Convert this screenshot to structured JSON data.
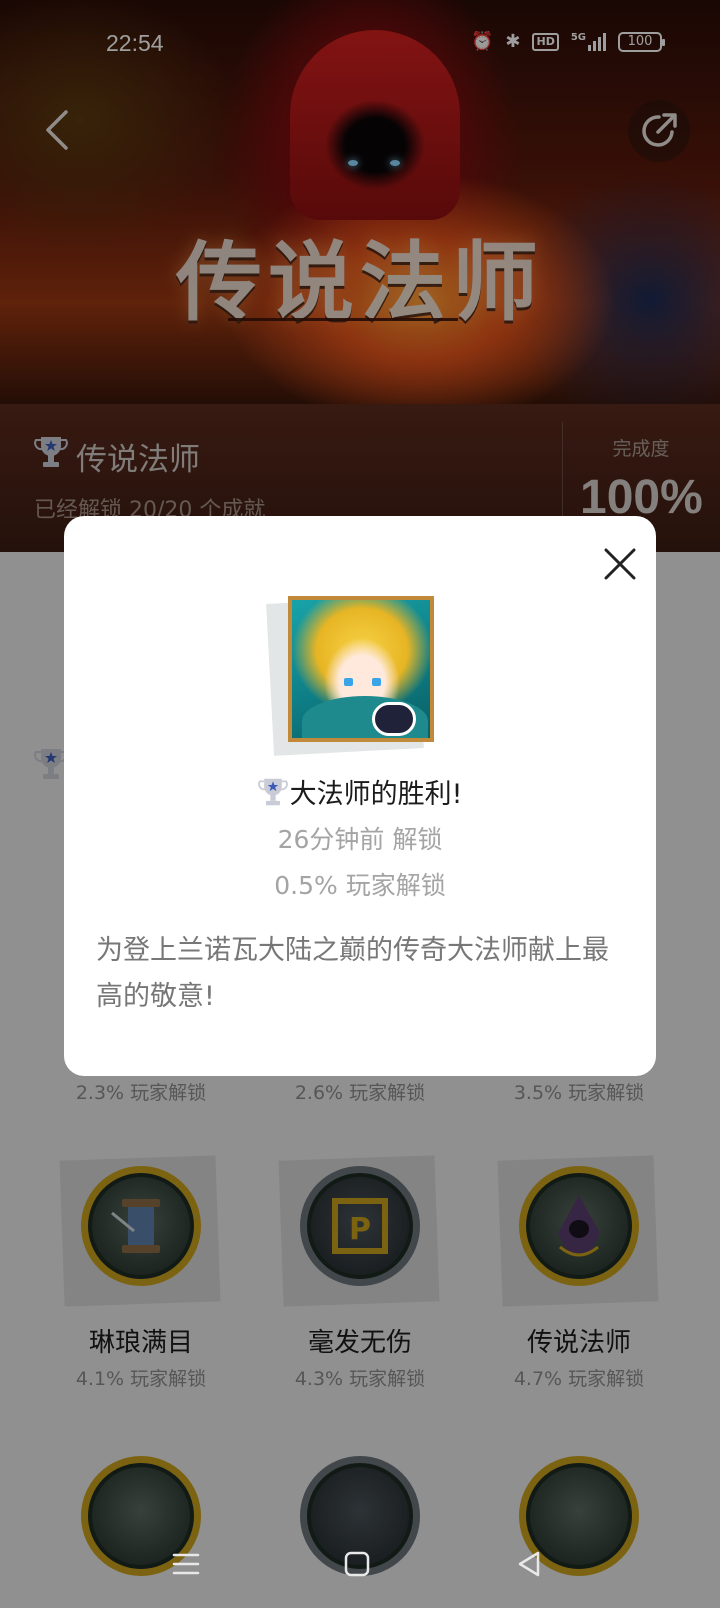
{
  "status_bar": {
    "time": "22:54",
    "network": "5G",
    "hd_label": "HD",
    "battery": "100"
  },
  "header": {
    "banner_title": "传说法师",
    "back_icon": "chevron-left-icon",
    "share_icon": "share-icon"
  },
  "summary": {
    "title": "传说法师",
    "unlocked_text": "已经解锁 20/20 个成就",
    "completion_label": "完成度",
    "completion_value": "100%",
    "completion_fraction": 1.0
  },
  "grid": {
    "row1_rates": [
      "2.3% 玩家解锁",
      "2.6% 玩家解锁",
      "3.5% 玩家解锁"
    ],
    "row2": [
      {
        "name": "琳琅满目",
        "rate": "4.1% 玩家解锁",
        "icon": "spool-medal-icon"
      },
      {
        "name": "毫发无伤",
        "rate": "4.3% 玩家解锁",
        "icon": "p-block-medal-icon"
      },
      {
        "name": "传说法师",
        "rate": "4.7% 玩家解锁",
        "icon": "hooded-wizard-medal-icon"
      }
    ]
  },
  "modal": {
    "title": "大法师的胜利!",
    "unlock_time": "26分钟前 解锁",
    "unlock_rate": "0.5% 玩家解锁",
    "description": "为登上兰诺瓦大陆之巅的传奇大法师献上最高的敬意!",
    "close_icon": "close-icon",
    "achievement_icon": "archmage-portrait-icon"
  },
  "colors": {
    "accent_gold": "#c9a11c",
    "modal_bg": "#ffffff",
    "muted_text": "#a4a4a4"
  }
}
